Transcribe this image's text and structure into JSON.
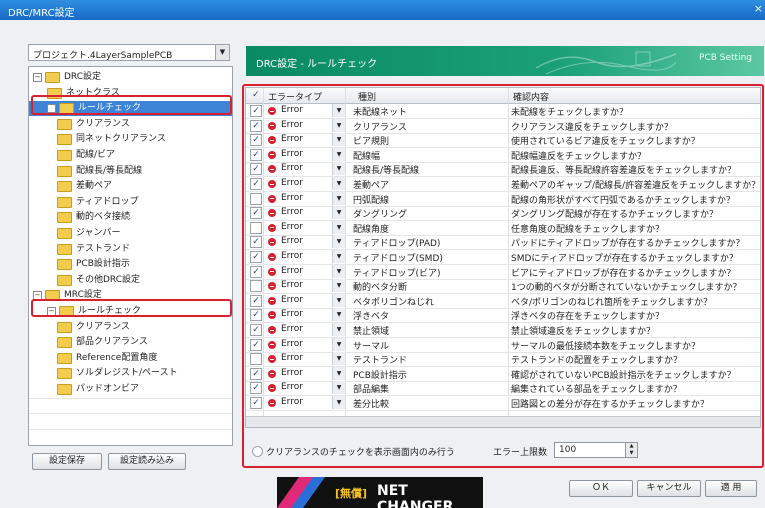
{
  "window": {
    "title": "DRC/MRC設定",
    "close": "×"
  },
  "left": {
    "project_select": "プロジェクト.4LayerSamplePCB",
    "tree": [
      {
        "label": "DRC設定",
        "level": 0,
        "expander": "⊟"
      },
      {
        "label": "ネットクラス",
        "level": 1
      },
      {
        "label": "ルールチェック",
        "level": 1,
        "expander": "⊟",
        "selected": true
      },
      {
        "label": "クリアランス",
        "level": 2
      },
      {
        "label": "同ネットクリアランス",
        "level": 2
      },
      {
        "label": "配線/ビア",
        "level": 2
      },
      {
        "label": "配線長/等長配線",
        "level": 2
      },
      {
        "label": "差動ペア",
        "level": 2
      },
      {
        "label": "ティアドロップ",
        "level": 2
      },
      {
        "label": "動的ベタ接続",
        "level": 2
      },
      {
        "label": "ジャンパー",
        "level": 2
      },
      {
        "label": "テストランド",
        "level": 2
      },
      {
        "label": "PCB設計指示",
        "level": 2
      },
      {
        "label": "その他DRC設定",
        "level": 2
      },
      {
        "label": "MRC設定",
        "level": 0,
        "expander": "⊟"
      },
      {
        "label": "ルールチェック",
        "level": 1,
        "expander": "⊟"
      },
      {
        "label": "クリアランス",
        "level": 2
      },
      {
        "label": "部品クリアランス",
        "level": 2
      },
      {
        "label": "Reference配置角度",
        "level": 2
      },
      {
        "label": "ソルダレジスト/ペースト",
        "level": 2
      },
      {
        "label": "パッドオンビア",
        "level": 2
      }
    ],
    "save_button": "設定保存",
    "load_button": "設定読み込み"
  },
  "banner": {
    "title": "DRC設定 - ルールチェック",
    "subtitle": "PCB Setting"
  },
  "table": {
    "headers": [
      "✓",
      "エラータイプ",
      "種別",
      "確認内容"
    ],
    "rows": [
      {
        "checked": true,
        "type": "Error",
        "kind": "未配線ネット",
        "desc": "未配線をチェックしますか？"
      },
      {
        "checked": true,
        "type": "Error",
        "kind": "クリアランス",
        "desc": "クリアランス違反をチェックしますか？"
      },
      {
        "checked": true,
        "type": "Error",
        "kind": "ビア規則",
        "desc": "使用されているビア違反をチェックしますか？"
      },
      {
        "checked": true,
        "type": "Error",
        "kind": "配線幅",
        "desc": "配線幅違反をチェックしますか？"
      },
      {
        "checked": true,
        "type": "Error",
        "kind": "配線長/等長配線",
        "desc": "配線長違反、等長配線許容差違反をチェックしますか？"
      },
      {
        "checked": true,
        "type": "Error",
        "kind": "差動ペア",
        "desc": "差動ペアのギャップ/配線長/許容差違反をチェックしますか？"
      },
      {
        "checked": false,
        "type": "Error",
        "kind": "円弧配線",
        "desc": "配線の角形状がすべて円弧であるかチェックしますか？"
      },
      {
        "checked": true,
        "type": "Error",
        "kind": "ダングリング",
        "desc": "ダングリング配線が存在するかチェックしますか？"
      },
      {
        "checked": false,
        "type": "Error",
        "kind": "配線角度",
        "desc": "任意角度の配線をチェックしますか？"
      },
      {
        "checked": true,
        "type": "Error",
        "kind": "ティアドロップ(PAD)",
        "desc": "パッドにティアドロップが存在するかチェックしますか？"
      },
      {
        "checked": true,
        "type": "Error",
        "kind": "ティアドロップ(SMD)",
        "desc": "SMDにティアドロップが存在するかチェックしますか？"
      },
      {
        "checked": true,
        "type": "Error",
        "kind": "ティアドロップ(ビア)",
        "desc": "ビアにティアドロップが存在するかチェックしますか？"
      },
      {
        "checked": false,
        "type": "Error",
        "kind": "動的ベタ分断",
        "desc": "1つの動的ベタが分断されていないかチェックしますか？"
      },
      {
        "checked": true,
        "type": "Error",
        "kind": "ベタポリゴンねじれ",
        "desc": "ベタ/ポリゴンのねじれ箇所をチェックしますか？"
      },
      {
        "checked": true,
        "type": "Error",
        "kind": "浮きベタ",
        "desc": "浮きベタの存在をチェックしますか？"
      },
      {
        "checked": true,
        "type": "Error",
        "kind": "禁止領域",
        "desc": "禁止領域違反をチェックしますか？"
      },
      {
        "checked": true,
        "type": "Error",
        "kind": "サーマル",
        "desc": "サーマルの最低接続本数をチェックしますか？"
      },
      {
        "checked": false,
        "type": "Error",
        "kind": "テストランド",
        "desc": "テストランドの配置をチェックしますか？"
      },
      {
        "checked": true,
        "type": "Error",
        "kind": "PCB設計指示",
        "desc": "確認がされていないPCB設計指示をチェックしますか？"
      },
      {
        "checked": true,
        "type": "Error",
        "kind": "部品編集",
        "desc": "編集されている部品をチェックしますか？"
      },
      {
        "checked": true,
        "type": "Error",
        "kind": "差分比較",
        "desc": "回路図との差分が存在するかチェックしますか？"
      }
    ]
  },
  "options": {
    "clearance_visible_only": "クリアランスのチェックを表示画面内のみ行う",
    "error_limit_label": "エラー上限数",
    "error_limit_value": "100"
  },
  "logo": {
    "tag": "[無償]",
    "name": "NET CHANGER"
  },
  "buttons": {
    "ok": "ＯＫ",
    "cancel": "キャンセル",
    "apply": "適 用"
  },
  "colors": {
    "accent": "#1aa077",
    "highlight": "#d8202e",
    "selection": "#3d83d6"
  }
}
